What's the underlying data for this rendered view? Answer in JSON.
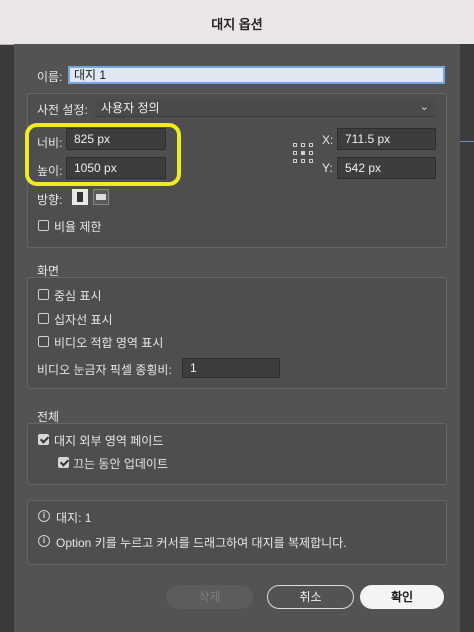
{
  "window": {
    "title": "대지 옵션"
  },
  "name": {
    "label": "이름:",
    "value": "대지 1"
  },
  "preset": {
    "label": "사전 설정:",
    "value": "사용자 정의"
  },
  "size": {
    "width_label": "너비:",
    "width_value": "825 px",
    "height_label": "높이:",
    "height_value": "1050 px"
  },
  "position": {
    "x_label": "X:",
    "x_value": "711.5 px",
    "y_label": "Y:",
    "y_value": "542 px"
  },
  "orientation": {
    "label": "방향:",
    "selected": "portrait"
  },
  "constrain": {
    "label": "비율 제한",
    "checked": false
  },
  "display": {
    "header": "화면",
    "center_mark": {
      "label": "중심 표시",
      "checked": false
    },
    "cross_hairs": {
      "label": "십자선 표시",
      "checked": false
    },
    "video_safe": {
      "label": "비디오 적합 영역 표시",
      "checked": false
    },
    "video_ruler_label": "비디오 눈금자 픽셀 종횡비:",
    "video_ruler_value": "1"
  },
  "global": {
    "header": "전체",
    "fade_region": {
      "label": "대지 외부 영역 페이드",
      "checked": true
    },
    "update_drag": {
      "label": "끄는 동안 업데이트",
      "checked": true
    }
  },
  "info": {
    "artboards": "대지: 1",
    "tip": "Option 키를 누르고 커서를 드래그하여 대지를 복제합니다."
  },
  "buttons": {
    "delete": "삭제",
    "cancel": "취소",
    "ok": "확인"
  }
}
